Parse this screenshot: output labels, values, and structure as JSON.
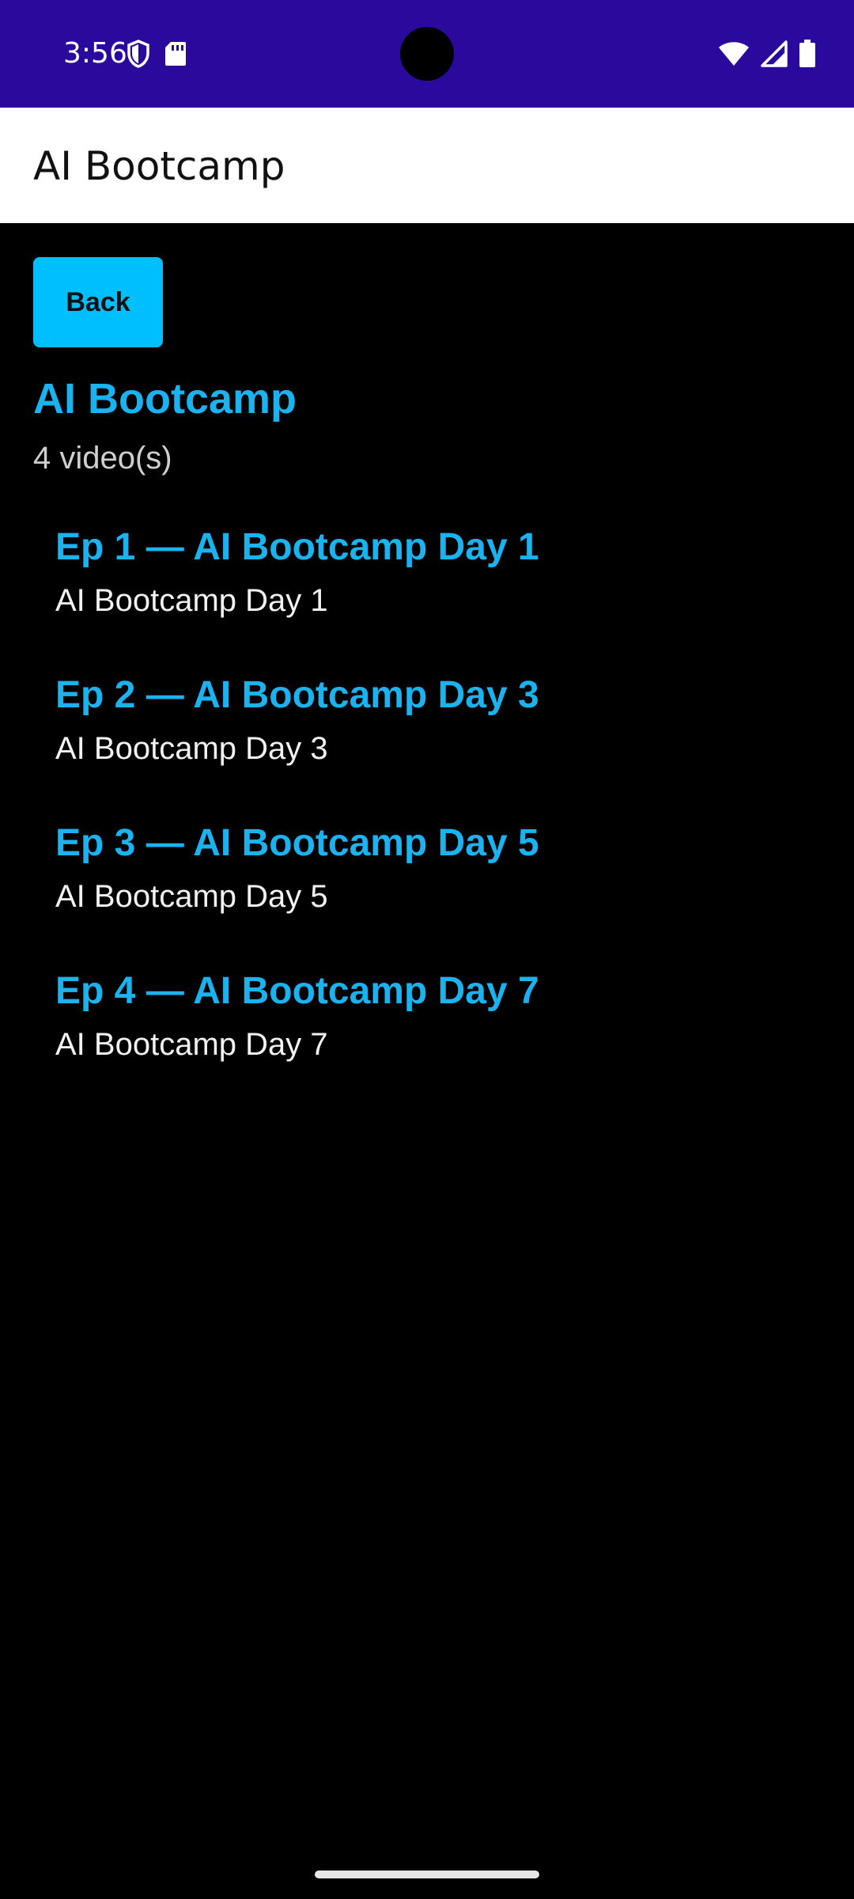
{
  "status_bar": {
    "time": "3:56",
    "left_icons": [
      "shield-icon",
      "sd-card-icon"
    ],
    "right_icons": [
      "wifi-icon",
      "signal-icon",
      "battery-icon"
    ],
    "background": "#2a0a9c"
  },
  "app_bar": {
    "title": "AI Bootcamp"
  },
  "back_button": {
    "label": "Back",
    "color": "#00bfff"
  },
  "playlist": {
    "title": "AI Bootcamp",
    "count_text": "4 video(s)",
    "accent": "#1ab3f0"
  },
  "videos": [
    {
      "title": "Ep 1 — AI Bootcamp Day 1",
      "description": "AI Bootcamp Day 1"
    },
    {
      "title": "Ep 2 — AI Bootcamp Day 3",
      "description": "AI Bootcamp Day 3"
    },
    {
      "title": "Ep 3 — AI Bootcamp Day 5",
      "description": "AI Bootcamp Day 5"
    },
    {
      "title": "Ep 4 — AI Bootcamp Day 7",
      "description": "AI Bootcamp Day 7"
    }
  ]
}
